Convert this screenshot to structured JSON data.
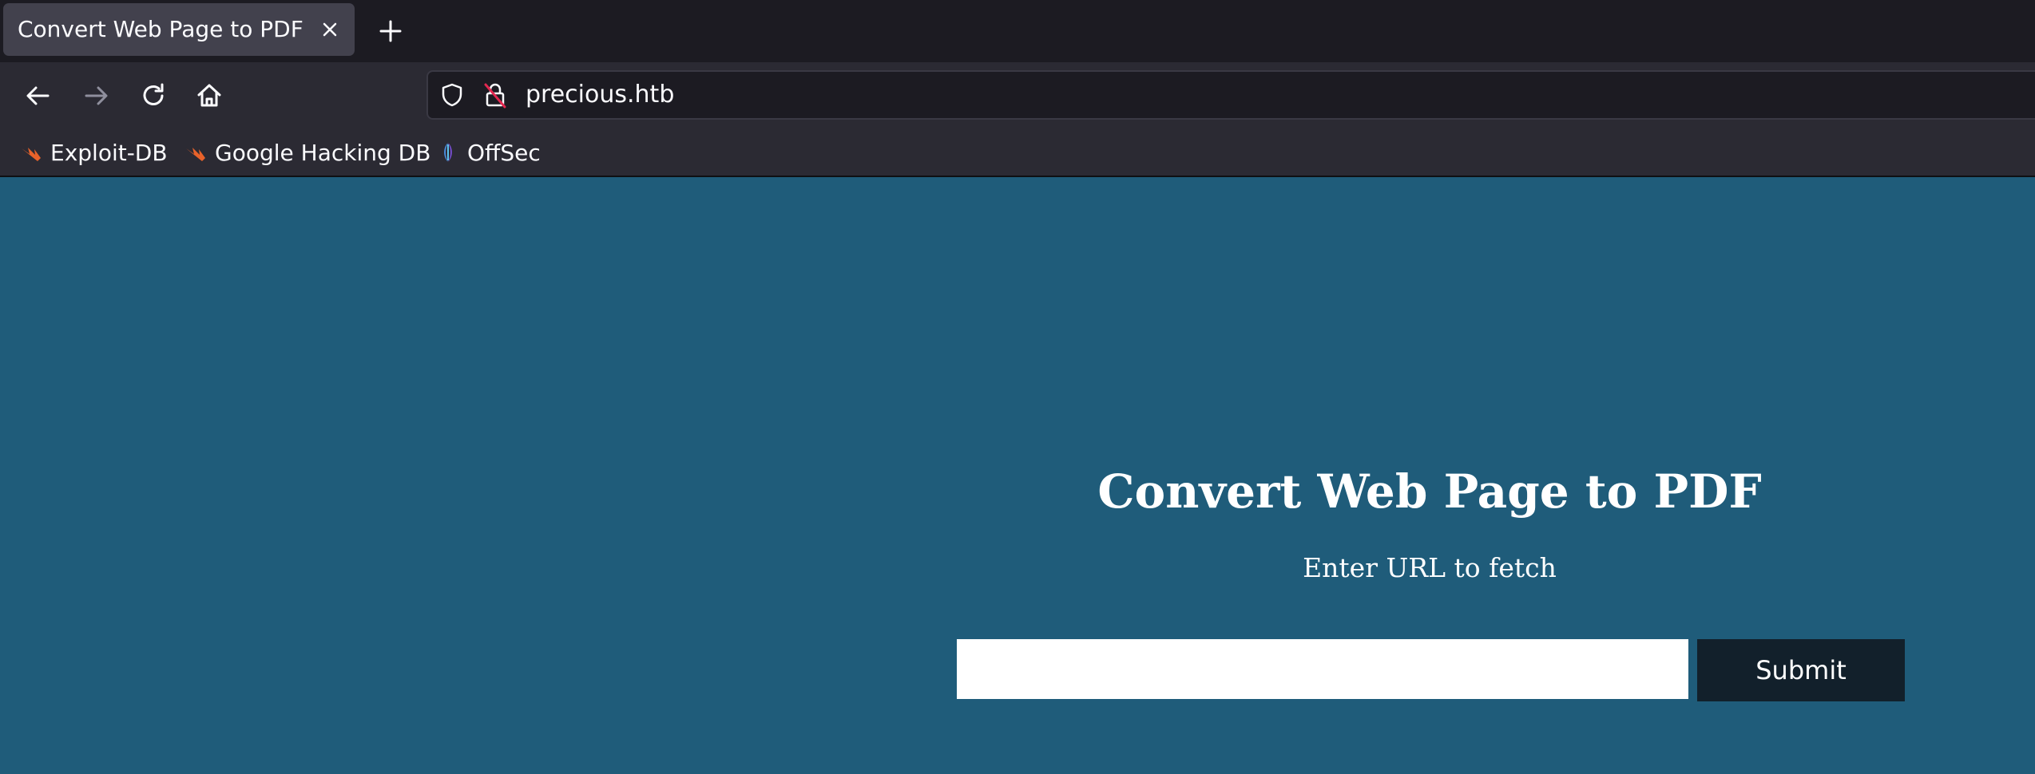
{
  "browser": {
    "tab": {
      "title": "Convert Web Page to PDF",
      "close_icon": "close-icon"
    },
    "new_tab_icon": "plus-icon",
    "nav": {
      "back_icon": "arrow-left-icon",
      "forward_icon": "arrow-right-icon",
      "reload_icon": "reload-icon",
      "home_icon": "home-icon"
    },
    "url": "precious.htb",
    "bookmarks": [
      {
        "label": "Exploit-DB",
        "icon": "exploitdb-icon"
      },
      {
        "label": "Google Hacking DB",
        "icon": "ghdb-icon"
      },
      {
        "label": "OffSec",
        "icon": "offsec-icon"
      }
    ]
  },
  "page": {
    "heading": "Convert Web Page to PDF",
    "subtext": "Enter URL to fetch",
    "url_input": {
      "value": "",
      "placeholder": ""
    },
    "submit_label": "Submit"
  },
  "colors": {
    "page_background": "#1f5c7a",
    "submit_background": "#12202b",
    "tabbar_background": "#1c1b22",
    "toolbar_background": "#2b2a33"
  }
}
